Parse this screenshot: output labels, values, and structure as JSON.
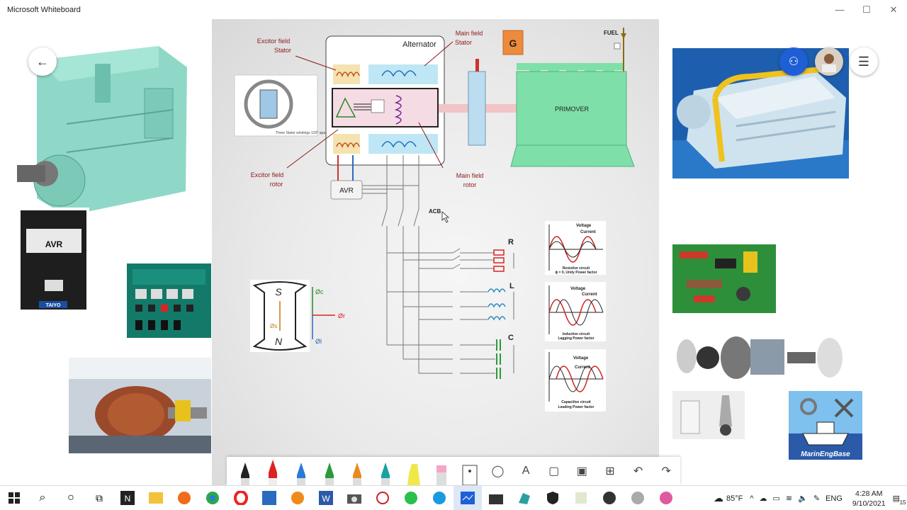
{
  "window": {
    "title": "Microsoft Whiteboard",
    "minimize": "—",
    "maximize": "☐",
    "close": "✕"
  },
  "diagram": {
    "alternator_label": "Alternator",
    "g_label": "G",
    "fuel_label": "FUEL",
    "primover_label": "PRIMOVER",
    "avr_label": "AVR",
    "acb_label": "ACB",
    "exciter_field_stator": [
      "Excitor field",
      "Stator"
    ],
    "main_field_stator": [
      "Main field",
      "Stator"
    ],
    "exciter_field_rotor": [
      "Excitor field",
      "rotor"
    ],
    "main_field_rotor": [
      "Main field",
      "rotor"
    ],
    "load_r": "R",
    "load_l": "L",
    "load_c": "C",
    "magnet_s": "S",
    "magnet_n": "N",
    "phi_c": "Øc",
    "phi_r": "Ør",
    "phi_l": "Øl",
    "phi_s": "Øs",
    "waveform_voltage": "Voltage",
    "waveform_current": "Current",
    "wave1_caption": [
      "Resistive circuit",
      "ϕ = 0, Unity Power factor"
    ],
    "wave2_caption": [
      "Inductive circuit",
      "Lagging Power factor"
    ],
    "wave3_caption": [
      "Capacitive circuit",
      "Leading Power factor"
    ],
    "stator_inset": [
      "Three Stator windings 120° apart"
    ]
  },
  "photos": {
    "avr_panel_text": "AVR",
    "avr_brand": "TAIYO",
    "marinengbase": "MarinEngBase"
  },
  "taskbar": {
    "weather": "85°F",
    "language": "ENG",
    "time": "4:28 AM",
    "date": "9/10/2021",
    "notifications": "15"
  },
  "colors": {
    "accent": "#1f5fd6",
    "engine_green": "#7ee0a8",
    "orange": "#ee8a3c",
    "dark_red": "#8b1a1a"
  }
}
